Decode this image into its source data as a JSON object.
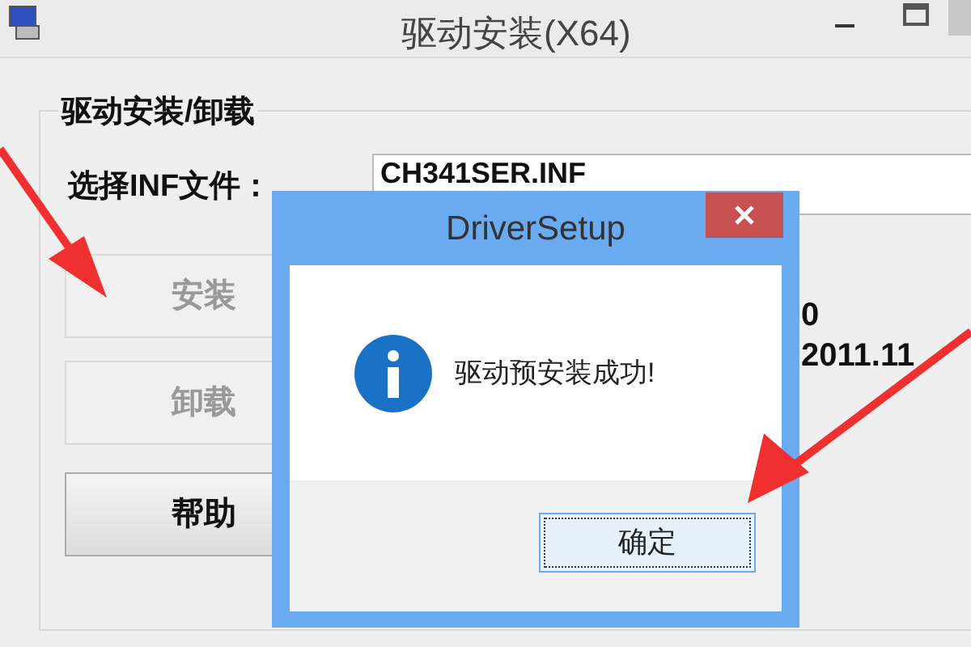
{
  "window": {
    "title": "驱动安装(X64)"
  },
  "group": {
    "title": "驱动安装/卸载",
    "inf_label": "选择INF文件：",
    "inf_value": "CH341SER.INF",
    "buttons": [
      {
        "label": "安装",
        "disabled": true
      },
      {
        "label": "卸载",
        "disabled": true
      },
      {
        "label": "帮助",
        "disabled": false
      }
    ],
    "info_lines": [
      "0",
      "2011.11"
    ]
  },
  "dialog": {
    "title": "DriverSetup",
    "message": "驱动预安装成功!",
    "ok": "确定"
  }
}
